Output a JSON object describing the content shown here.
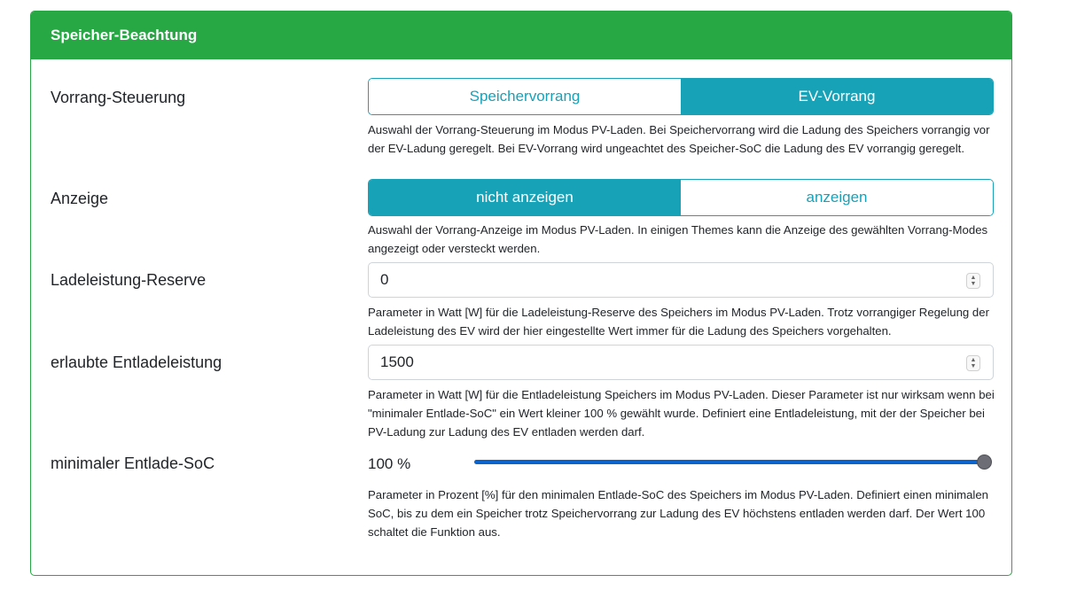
{
  "card": {
    "title": "Speicher-Beachtung"
  },
  "colors": {
    "header": "#28a745",
    "accent": "#17a2b8",
    "slider": "#0b63ce"
  },
  "priority": {
    "label": "Vorrang-Steuerung",
    "options": [
      "Speichervorrang",
      "EV-Vorrang"
    ],
    "selected": "EV-Vorrang",
    "help": "Auswahl der Vorrang-Steuerung im Modus PV-Laden. Bei Speichervorrang wird die Ladung des Speichers vorrangig vor der EV-Ladung geregelt. Bei EV-Vorrang wird ungeachtet des Speicher-SoC die Ladung des EV vorrangig geregelt."
  },
  "display": {
    "label": "Anzeige",
    "options": [
      "nicht anzeigen",
      "anzeigen"
    ],
    "selected": "nicht anzeigen",
    "help": "Auswahl der Vorrang-Anzeige im Modus PV-Laden. In einigen Themes kann die Anzeige des gewählten Vorrang-Modes angezeigt oder versteckt werden."
  },
  "reserve": {
    "label": "Ladeleistung-Reserve",
    "value": "0",
    "help": "Parameter in Watt [W] für die Ladeleistung-Reserve des Speichers im Modus PV-Laden. Trotz vorrangiger Regelung der Ladeleistung des EV wird der hier eingestellte Wert immer für die Ladung des Speichers vorgehalten."
  },
  "discharge": {
    "label": "erlaubte Entladeleistung",
    "value": "1500",
    "help": "Parameter in Watt [W] für die Entladeleistung Speichers im Modus PV-Laden. Dieser Parameter ist nur wirksam wenn bei \"minimaler Entlade-SoC\" ein Wert kleiner 100 % gewählt wurde. Definiert eine Entladeleistung, mit der der Speicher bei PV-Ladung zur Ladung des EV entladen werden darf."
  },
  "minsoc": {
    "label": "minimaler Entlade-SoC",
    "value_text": "100 %",
    "level": 1.0,
    "help": "Parameter in Prozent [%] für den minimalen Entlade-SoC des Speichers im Modus PV-Laden. Definiert einen minimalen SoC, bis zu dem ein Speicher trotz Speichervorrang zur Ladung des EV höchstens entladen werden darf. Der Wert 100 schaltet die Funktion aus."
  }
}
